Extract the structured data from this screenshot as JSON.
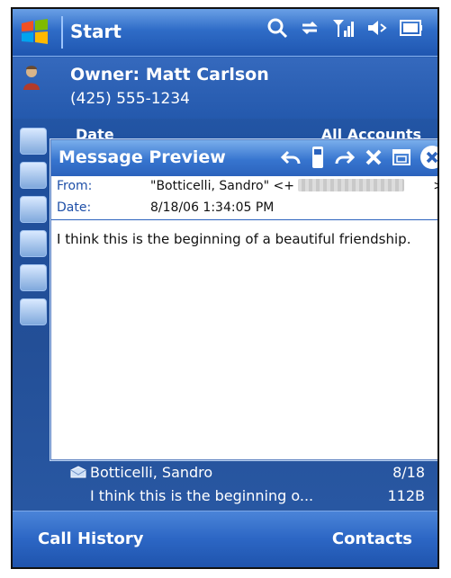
{
  "titlebar": {
    "start_label": "Start",
    "icons": [
      "search-icon",
      "sync-icon",
      "signal-icon",
      "volume-icon",
      "battery-icon"
    ]
  },
  "owner": {
    "name": "Owner: Matt Carlson",
    "phone": "(425) 555-1234"
  },
  "background_strip": {
    "left_label": "Date",
    "right_label": "All Accounts"
  },
  "popup": {
    "title": "Message Preview",
    "tools": [
      "reply-icon",
      "phone-icon",
      "forward-icon",
      "delete-icon",
      "window-icon",
      "close-icon"
    ],
    "from_label": "From:",
    "from_value": "\"Botticelli, Sandro\" <+",
    "from_end": ">",
    "date_label": "Date:",
    "date_value": "8/18/06 1:34:05 PM",
    "body": "I think this is the beginning of a beautiful friendship."
  },
  "list": {
    "name": "Botticelli, Sandro",
    "date": "8/18",
    "preview": "I think this is the beginning o...",
    "size": "112B"
  },
  "softkeys": {
    "left": "Call History",
    "right": "Contacts"
  },
  "colors": {
    "accent": "#2f6cc7",
    "popup_border": "#5a7fc0"
  }
}
